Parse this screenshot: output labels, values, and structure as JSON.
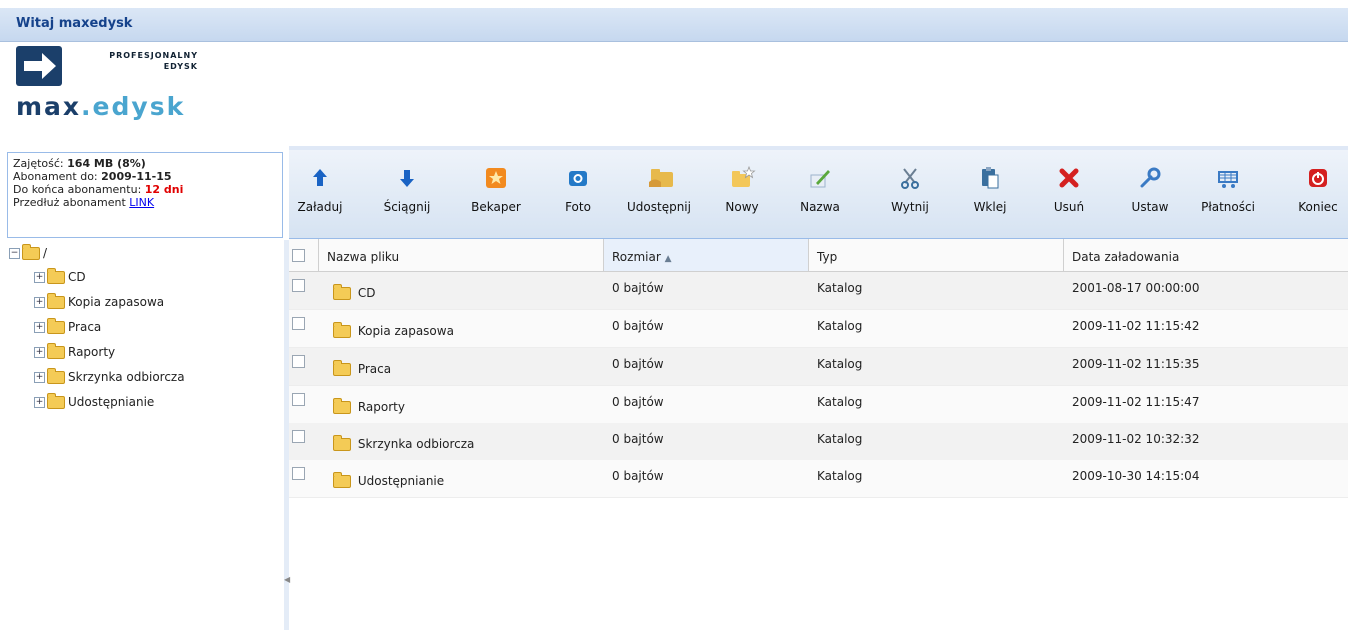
{
  "header": {
    "welcome": "Witaj maxedysk"
  },
  "logo": {
    "tag_line1": "PROFESJONALNY",
    "tag_line2": "EDYSK",
    "word_a": "max",
    "word_b": ".edysk"
  },
  "info": {
    "usage_label": "Zajętość:",
    "usage_value": "164 MB (8%)",
    "sub_label": "Abonament do:",
    "sub_value": "2009-11-15",
    "end_label": "Do końca abonamentu:",
    "end_value": "12 dni",
    "extend_label": "Przedłuż abonament",
    "extend_link": "LINK"
  },
  "tree": {
    "root": "/",
    "items": [
      "CD",
      "Kopia zapasowa",
      "Praca",
      "Raporty",
      "Skrzynka odbiorcza",
      "Udostępnianie"
    ]
  },
  "toolbar": [
    {
      "label": "Załaduj",
      "icon": "upload-arrow-icon",
      "color": "#1a63c4"
    },
    {
      "label": "Ściągnij",
      "icon": "download-arrow-icon",
      "color": "#1a63c4"
    },
    {
      "label": "Bekaper",
      "icon": "backup-star-icon",
      "color": "#f28a1f"
    },
    {
      "label": "Foto",
      "icon": "camera-icon",
      "color": "#2479c7"
    },
    {
      "label": "Udostępnij",
      "icon": "share-folder-icon",
      "color": "#e7b94c"
    },
    {
      "label": "Nowy",
      "icon": "new-folder-icon",
      "color": "#f3c75a"
    },
    {
      "label": "Nazwa",
      "icon": "rename-pen-icon",
      "color": "#5aa83c"
    },
    {
      "label": "Wytnij",
      "icon": "scissors-icon",
      "color": "#3a6f9e"
    },
    {
      "label": "Wklej",
      "icon": "paste-clipboard-icon",
      "color": "#3a6f9e"
    },
    {
      "label": "Usuń",
      "icon": "delete-x-icon",
      "color": "#d42020"
    },
    {
      "label": "Ustaw",
      "icon": "settings-wrench-icon",
      "color": "#3a7ac4"
    },
    {
      "label": "Płatności",
      "icon": "cart-icon",
      "color": "#3a7ac4"
    },
    {
      "label": "Koniec",
      "icon": "power-icon",
      "color": "#d42020"
    }
  ],
  "grid": {
    "columns": {
      "name": "Nazwa pliku",
      "size": "Rozmiar",
      "type": "Typ",
      "date": "Data załadowania"
    },
    "rows": [
      {
        "name": "CD",
        "size": "0 bajtów",
        "type": "Katalog",
        "date": "2001-08-17 00:00:00"
      },
      {
        "name": "Kopia zapasowa",
        "size": "0 bajtów",
        "type": "Katalog",
        "date": "2009-11-02 11:15:42"
      },
      {
        "name": "Praca",
        "size": "0 bajtów",
        "type": "Katalog",
        "date": "2009-11-02 11:15:35"
      },
      {
        "name": "Raporty",
        "size": "0 bajtów",
        "type": "Katalog",
        "date": "2009-11-02 11:15:47"
      },
      {
        "name": "Skrzynka odbiorcza",
        "size": "0 bajtów",
        "type": "Katalog",
        "date": "2009-11-02 10:32:32"
      },
      {
        "name": "Udostępnianie",
        "size": "0 bajtów",
        "type": "Katalog",
        "date": "2009-10-30 14:15:04"
      }
    ]
  }
}
